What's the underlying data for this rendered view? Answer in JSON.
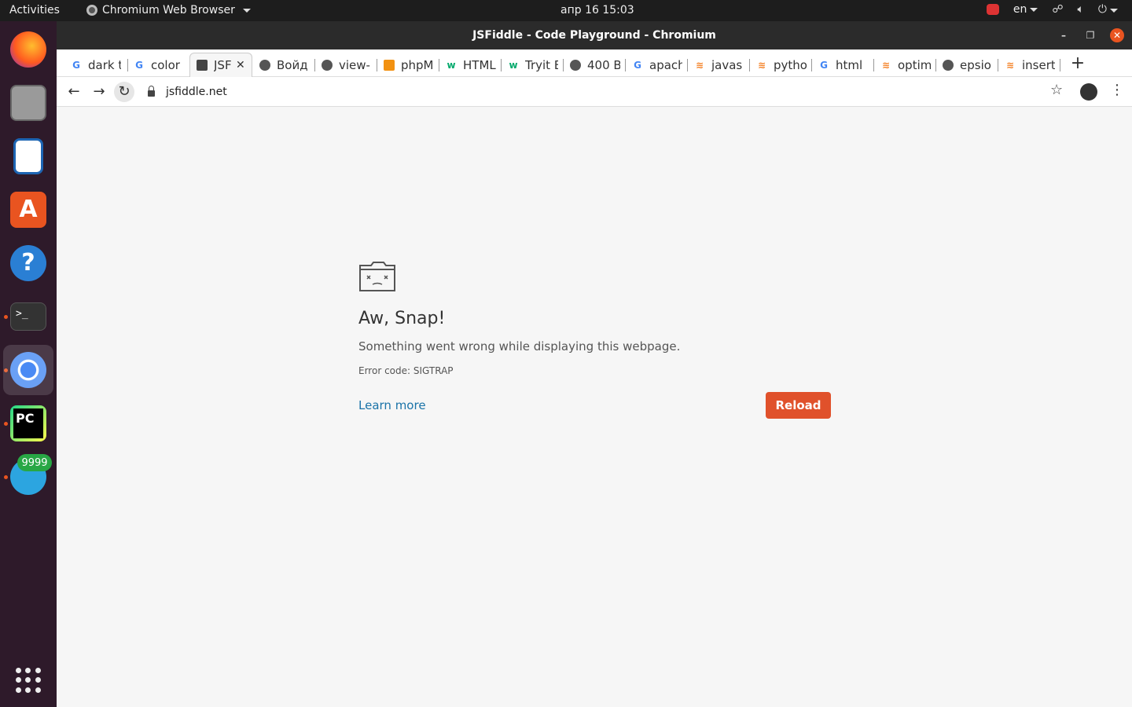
{
  "topbar": {
    "activities": "Activities",
    "app_name": "Chromium Web Browser",
    "clock": "апр 16  15:03",
    "lang": "en"
  },
  "dock": {
    "badge": "9999"
  },
  "window": {
    "title": "JSFiddle - Code Playground - Chromium"
  },
  "tabs": [
    {
      "label": "dark t",
      "icon": "google-icon"
    },
    {
      "label": "color",
      "icon": "google-icon"
    },
    {
      "label": "JSF",
      "icon": "jsfiddle-icon"
    },
    {
      "label": "Войд",
      "icon": "globe-icon"
    },
    {
      "label": "view-",
      "icon": "globe-icon"
    },
    {
      "label": "phpM",
      "icon": "phpmyadmin-icon"
    },
    {
      "label": "HTML",
      "icon": "w3schools-icon"
    },
    {
      "label": "Tryit E",
      "icon": "w3schools-icon"
    },
    {
      "label": "400 B",
      "icon": "globe-icon"
    },
    {
      "label": "apach",
      "icon": "google-icon"
    },
    {
      "label": "javas",
      "icon": "stackoverflow-icon"
    },
    {
      "label": "pytho",
      "icon": "stackoverflow-icon"
    },
    {
      "label": "html",
      "icon": "google-icon"
    },
    {
      "label": "optim",
      "icon": "stackoverflow-icon"
    },
    {
      "label": "epsio",
      "icon": "globe-icon"
    },
    {
      "label": "insert",
      "icon": "stackoverflow-icon"
    }
  ],
  "toolbar": {
    "url": "jsfiddle.net"
  },
  "error": {
    "title": "Aw, Snap!",
    "message": "Something went wrong while displaying this webpage.",
    "code": "Error code: SIGTRAP",
    "learn_more": "Learn more",
    "reload": "Reload"
  },
  "colors": {
    "accent": "#e0512b",
    "link": "#1a73a8"
  }
}
